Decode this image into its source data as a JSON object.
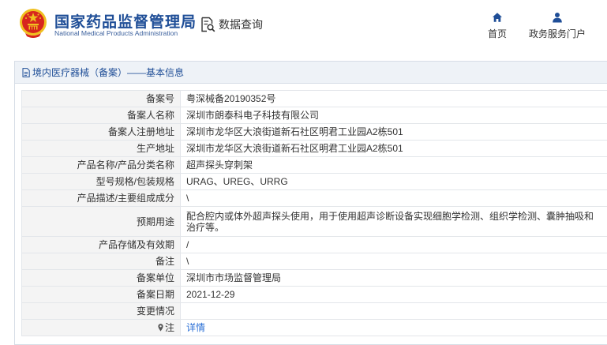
{
  "header": {
    "brand_cn": "国家药品监督管理局",
    "brand_en": "National Medical Products Administration",
    "query_label": "数据查询",
    "nav": {
      "home_label": "首页",
      "service_label": "政务服务门户"
    }
  },
  "colors": {
    "brand_blue": "#1f4e97",
    "emblem_red": "#d7261e",
    "emblem_gold": "#f0c020",
    "link_blue": "#2a6fd6",
    "key_bg": "#f4f4f4"
  },
  "icons": {
    "emblem": "national-emblem",
    "query": "document-search-icon",
    "home": "home-icon",
    "service": "person-icon",
    "title": "document-icon",
    "note": "pin-icon"
  },
  "panel": {
    "title": "境内医疗器械（备案）——基本信息"
  },
  "record": {
    "rows": [
      {
        "label": "备案号",
        "value": "粤深械备20190352号"
      },
      {
        "label": "备案人名称",
        "value": "深圳市朗泰科电子科技有限公司"
      },
      {
        "label": "备案人注册地址",
        "value": "深圳市龙华区大浪街道新石社区明君工业园A2栋501"
      },
      {
        "label": "生产地址",
        "value": "深圳市龙华区大浪街道新石社区明君工业园A2栋501"
      },
      {
        "label": "产品名称/产品分类名称",
        "value": "超声探头穿刺架"
      },
      {
        "label": "型号规格/包装规格",
        "value": "URAG、UREG、URRG"
      },
      {
        "label": "产品描述/主要组成成分",
        "value": "\\"
      },
      {
        "label": "预期用途",
        "value": "配合腔内或体外超声探头使用，用于使用超声诊断设备实现细胞学检测、组织学检测、囊肿抽吸和治疗等。"
      },
      {
        "label": "产品存储及有效期",
        "value": "/"
      },
      {
        "label": "备注",
        "value": "\\"
      },
      {
        "label": "备案单位",
        "value": "深圳市市场监督管理局"
      },
      {
        "label": "备案日期",
        "value": "2021-12-29"
      },
      {
        "label": "变更情况",
        "value": ""
      },
      {
        "label": "注",
        "value": "详情"
      }
    ]
  }
}
